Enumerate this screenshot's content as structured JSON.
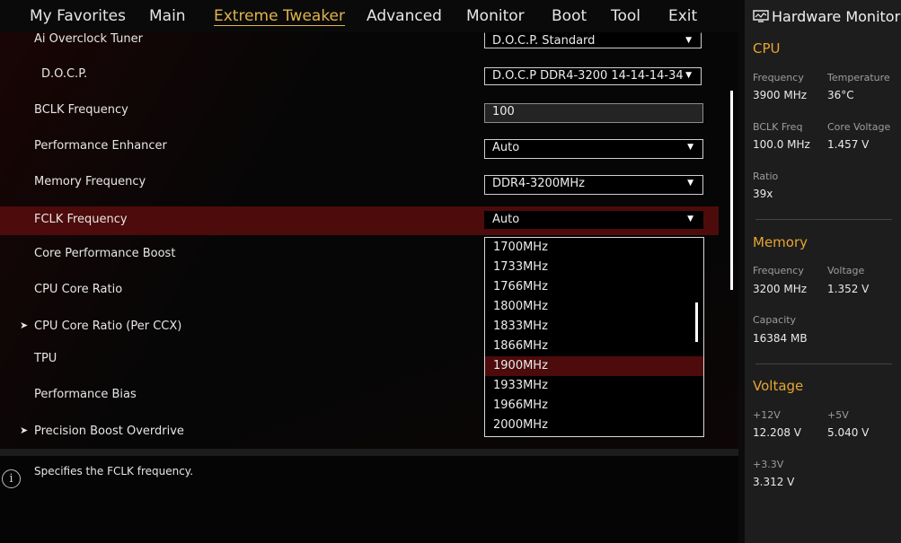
{
  "topmenu": {
    "items": [
      "My Favorites",
      "Main",
      "Extreme Tweaker",
      "Advanced",
      "Monitor",
      "Boot",
      "Tool",
      "Exit"
    ],
    "active": "Extreme Tweaker"
  },
  "settings": [
    {
      "label": "Ai Overclock Tuner",
      "value": "D.O.C.P. Standard"
    },
    {
      "label": "D.O.C.P.",
      "value": "D.O.C.P DDR4-3200 14-14-14-34"
    },
    {
      "label": "BCLK Frequency",
      "value": "100"
    },
    {
      "label": "Performance Enhancer",
      "value": "Auto"
    },
    {
      "label": "Memory Frequency",
      "value": "DDR4-3200MHz"
    },
    {
      "label": "FCLK Frequency",
      "value": "Auto"
    },
    {
      "label": "Core Performance Boost"
    },
    {
      "label": "CPU Core Ratio"
    },
    {
      "label": "CPU Core Ratio (Per CCX)"
    },
    {
      "label": "TPU"
    },
    {
      "label": "Performance Bias"
    },
    {
      "label": "Precision Boost Overdrive"
    }
  ],
  "dropdown": {
    "options": [
      "1700MHz",
      "1733MHz",
      "1766MHz",
      "1800MHz",
      "1833MHz",
      "1866MHz",
      "1900MHz",
      "1933MHz",
      "1966MHz",
      "2000MHz"
    ],
    "highlighted": "1900MHz"
  },
  "help": {
    "icon": "info-icon",
    "text": "Specifies the FCLK frequency."
  },
  "monitor": {
    "title": "Hardware Monitor",
    "cpu": {
      "heading": "CPU",
      "frequency_label": "Frequency",
      "frequency": "3900 MHz",
      "temperature_label": "Temperature",
      "temperature": "36°C",
      "bclk_label": "BCLK Freq",
      "bclk": "100.0 MHz",
      "core_voltage_label": "Core Voltage",
      "core_voltage": "1.457 V",
      "ratio_label": "Ratio",
      "ratio": "39x"
    },
    "memory": {
      "heading": "Memory",
      "frequency_label": "Frequency",
      "frequency": "3200 MHz",
      "voltage_label": "Voltage",
      "voltage": "1.352 V",
      "capacity_label": "Capacity",
      "capacity": "16384 MB"
    },
    "voltage": {
      "heading": "Voltage",
      "v12_label": "+12V",
      "v12": "12.208 V",
      "v5_label": "+5V",
      "v5": "5.040 V",
      "v33_label": "+3.3V",
      "v33": "3.312 V"
    }
  },
  "colors": {
    "accent": "#e0b44a",
    "selected_row": "#4d0b0b",
    "section_heading": "#e6a532"
  }
}
